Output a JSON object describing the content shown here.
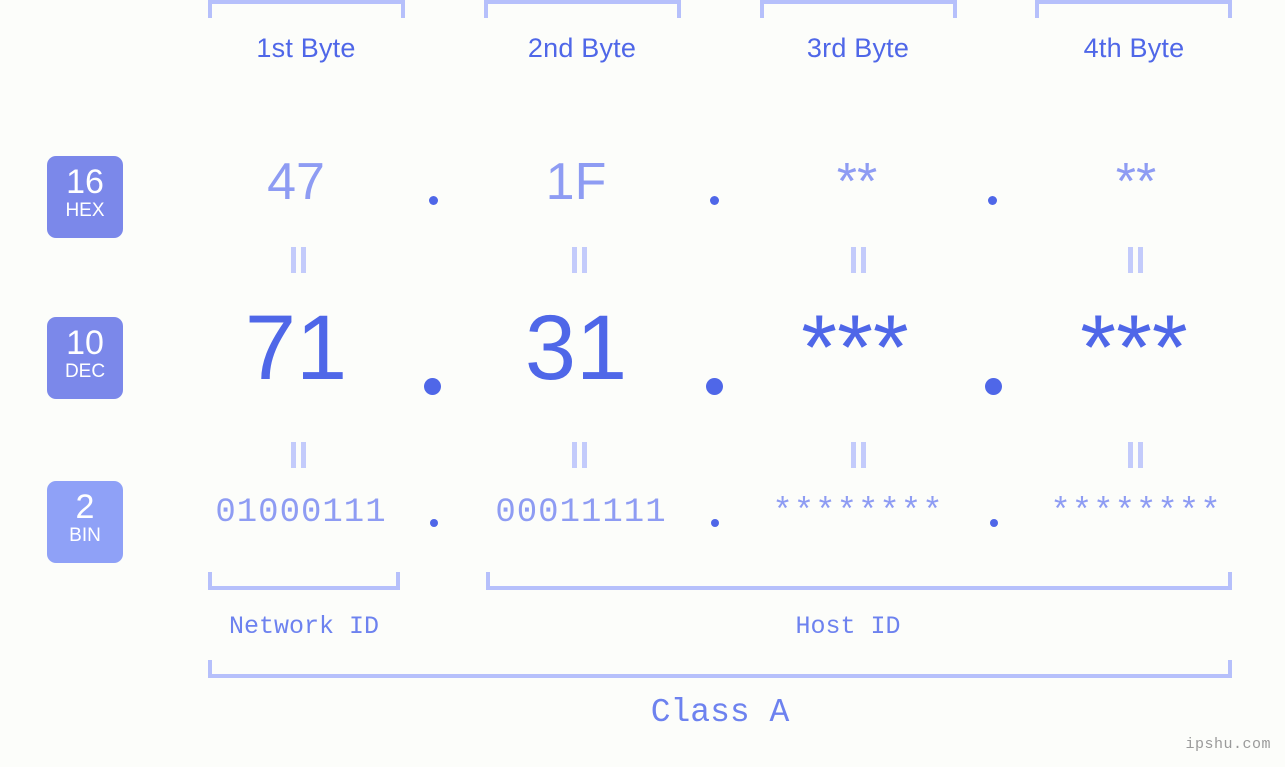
{
  "page": {
    "background_color": "#fcfdfa",
    "accent_color": "#4f67e8",
    "accent_light_color": "#8e9cf3",
    "bracket_color": "#b6c0fb",
    "watermark": "ipshu.com"
  },
  "byte_headers": [
    {
      "label": "1st Byte"
    },
    {
      "label": "2nd Byte"
    },
    {
      "label": "3rd Byte"
    },
    {
      "label": "4th Byte"
    }
  ],
  "bases": {
    "hex": {
      "number": "16",
      "name": "HEX",
      "badge_color": "#7b88ea"
    },
    "dec": {
      "number": "10",
      "name": "DEC",
      "badge_color": "#7b88ea"
    },
    "bin": {
      "number": "2",
      "name": "BIN",
      "badge_color": "#8fa1f7"
    }
  },
  "rows": {
    "hex": {
      "values": [
        "47",
        "1F",
        "**",
        "**"
      ]
    },
    "dec": {
      "values": [
        "71",
        "31",
        "***",
        "***"
      ]
    },
    "bin": {
      "values": [
        "01000111",
        "00011111",
        "********",
        "********"
      ]
    }
  },
  "separators": {
    "dot": "."
  },
  "sections": {
    "network_id": "Network ID",
    "host_id": "Host ID",
    "class": "Class A"
  }
}
